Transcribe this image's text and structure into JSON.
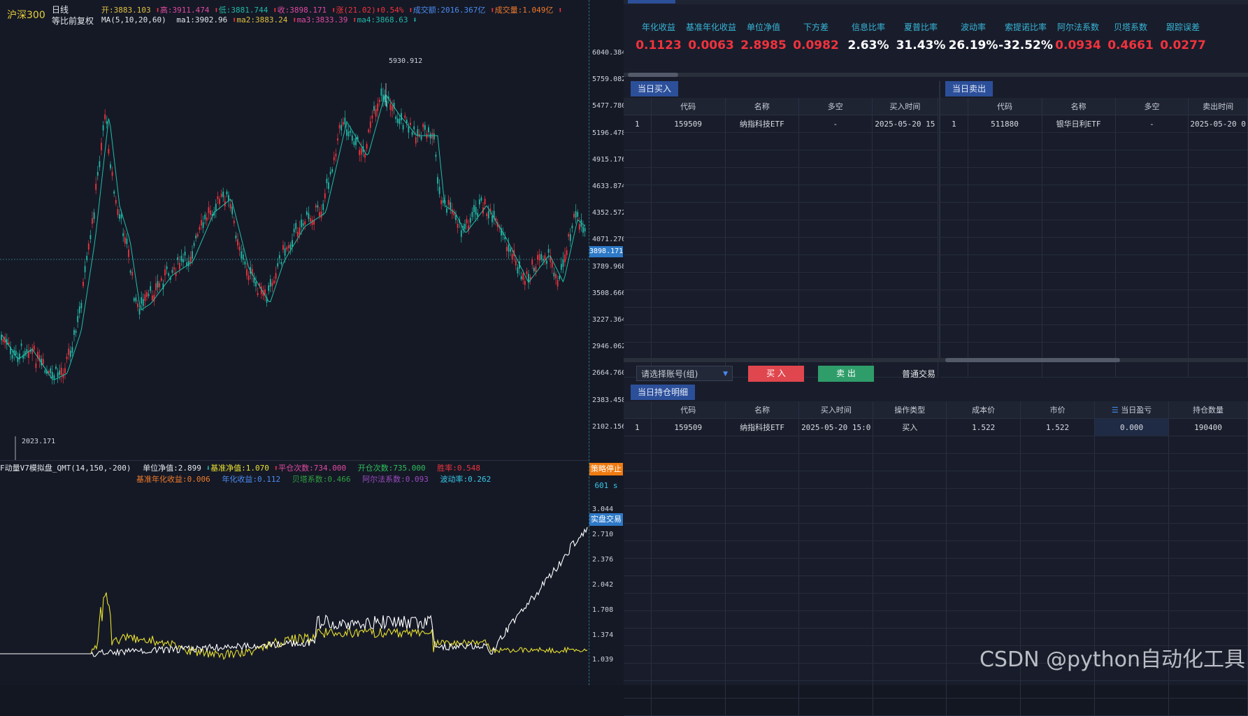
{
  "chart_header": {
    "index_name": "沪深300",
    "period": "日线",
    "adjust": "等比前复权",
    "open_label": "开:",
    "open": "3883.103",
    "high_label": "高:",
    "high": "3911.474",
    "low_label": "低:",
    "low": "3881.744",
    "close_label": "收:",
    "close": "3898.171",
    "change_label": "涨(21.02)",
    "change_pct": "0.54%",
    "amount_label": "成交额:",
    "amount": "2016.367亿",
    "volume_label": "成交量:",
    "volume": "1.049亿",
    "ma_label": "MA(5,10,20,60)",
    "ma1_label": "ma1:",
    "ma1": "3902.96",
    "ma2_label": "ma2:",
    "ma2": "3883.24",
    "ma3_label": "ma3:",
    "ma3": "3833.39",
    "ma4_label": "ma4:",
    "ma4": "3868.63"
  },
  "price_axis": [
    "6040.384",
    "5759.082",
    "5477.780",
    "5196.478",
    "4915.176",
    "4633.874",
    "4352.572",
    "4071.270",
    "3789.968",
    "3508.666",
    "3227.364",
    "2946.062",
    "2664.760",
    "2383.458",
    "2102.156"
  ],
  "price_annotations": {
    "high": "5930.912",
    "low": "2023.171",
    "current": "3898.171"
  },
  "strategy_header": {
    "name": "F动量V7模拟盘_QMT(14,150,-200)",
    "nav_label": "单位净值:",
    "nav": "2.899",
    "bench_label": "基准净值:",
    "bench": "1.070",
    "close_count_label": "平仓次数:",
    "close_count": "734.000",
    "open_count_label": "开仓次数:",
    "open_count": "735.000",
    "win_label": "胜率:",
    "win": "0.548",
    "bench_ann_label": "基准年化收益:",
    "bench_ann": "0.006",
    "ann_label": "年化收益:",
    "ann": "0.112",
    "beta_label": "贝塔系数:",
    "beta": "0.466",
    "alpha_label": "阿尔法系数:",
    "alpha": "0.093",
    "vol_label": "波动率:",
    "vol": "0.262",
    "stop_btn": "策略停止",
    "timer": "601 s",
    "live_btn": "实盘交易"
  },
  "nav_axis": [
    "3.044",
    "2.710",
    "2.376",
    "2.042",
    "1.708",
    "1.374",
    "1.039"
  ],
  "metrics": [
    {
      "label": "年化收益",
      "value": "0.1123",
      "color": "#f0333d"
    },
    {
      "label": "基准年化收益",
      "value": "0.0063",
      "color": "#f0333d"
    },
    {
      "label": "单位净值",
      "value": "2.8985",
      "color": "#f0333d"
    },
    {
      "label": "下方差",
      "value": "0.0982",
      "color": "#f0333d"
    },
    {
      "label": "信息比率",
      "value": "2.63%",
      "color": "#ffffff"
    },
    {
      "label": "夏普比率",
      "value": "31.43%",
      "color": "#ffffff"
    },
    {
      "label": "波动率",
      "value": "26.19%",
      "color": "#ffffff"
    },
    {
      "label": "索提诺比率",
      "value": "-32.52%",
      "color": "#ffffff"
    },
    {
      "label": "阿尔法系数",
      "value": "0.0934",
      "color": "#f0333d"
    },
    {
      "label": "贝塔系数",
      "value": "0.4661",
      "color": "#f0333d"
    },
    {
      "label": "跟踪误差",
      "value": "0.0277",
      "color": "#f0333d"
    }
  ],
  "buy_panel": {
    "tab": "当日买入",
    "columns": [
      "",
      "代码",
      "名称",
      "多空",
      "买入时间"
    ],
    "rows": [
      [
        "1",
        "159509",
        "纳指科技ETF",
        "-",
        "2025-05-20 15"
      ]
    ]
  },
  "sell_panel": {
    "tab": "当日卖出",
    "columns": [
      "",
      "代码",
      "名称",
      "多空",
      "卖出时间"
    ],
    "rows": [
      [
        "1",
        "511880",
        "银华日利ETF",
        "-",
        "2025-05-20 0"
      ]
    ]
  },
  "trade_bar": {
    "account_placeholder": "请选择账号(组)",
    "buy_btn": "买 入",
    "sell_btn": "卖 出",
    "mode": "普通交易"
  },
  "holdings": {
    "tab": "当日持仓明细",
    "columns": [
      "",
      "代码",
      "名称",
      "买入时间",
      "操作类型",
      "成本价",
      "市价",
      "当日盈亏",
      "持仓数量"
    ],
    "rows": [
      [
        "1",
        "159509",
        "纳指科技ETF",
        "2025-05-20 15:0",
        "买入",
        "1.522",
        "1.522",
        "0.000",
        "190400"
      ]
    ]
  },
  "watermark": "CSDN @python自动化工具",
  "colors": {
    "up": "#f0333d",
    "down": "#22b8a6",
    "ma": "#1fbfa8",
    "nav": "#ffffff",
    "bench": "#e8e030",
    "accent": "#2c4f9a"
  }
}
